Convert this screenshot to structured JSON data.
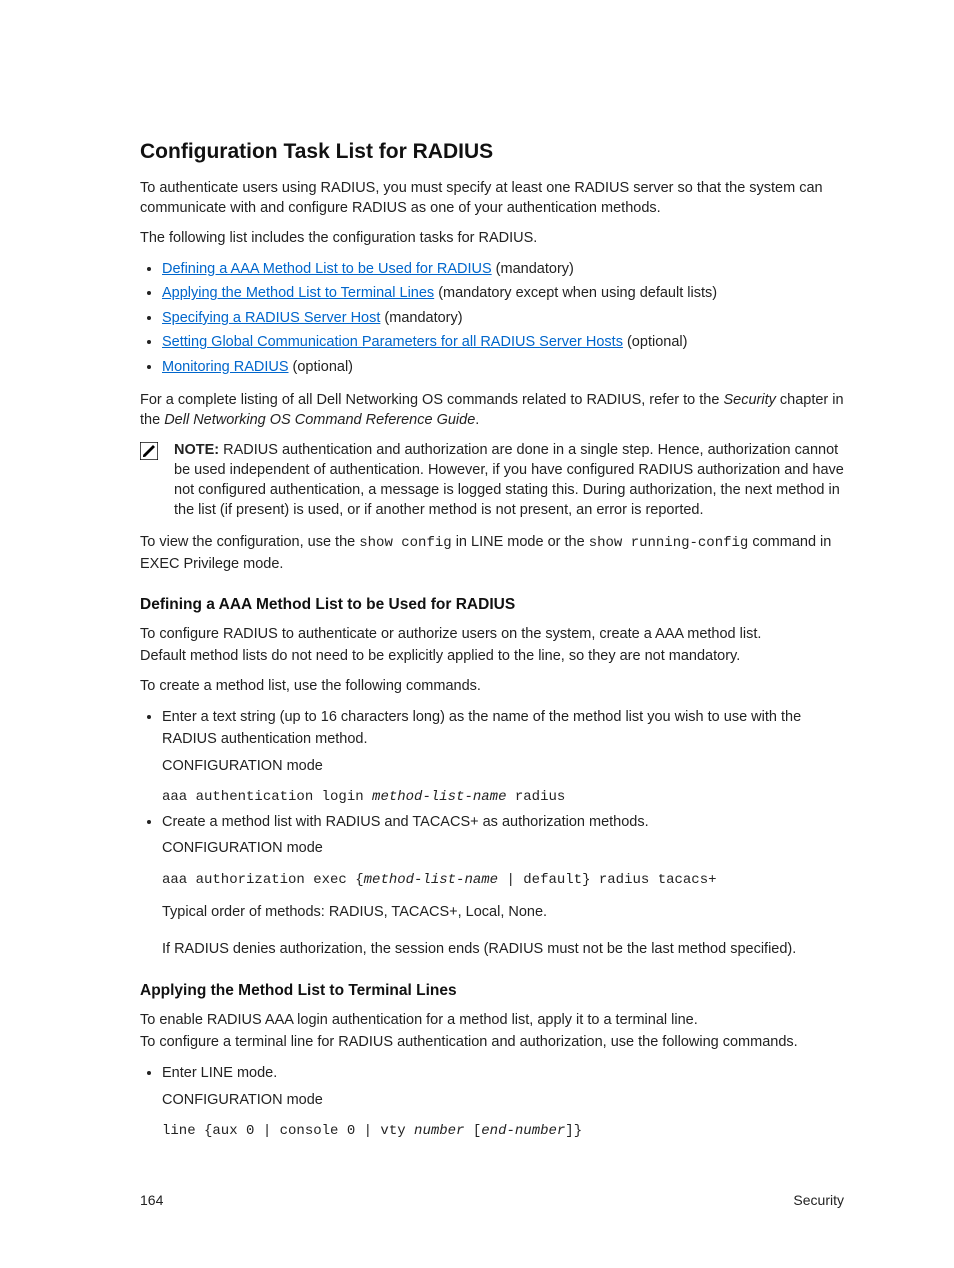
{
  "title": "Configuration Task List for RADIUS",
  "intro1": "To authenticate users using RADIUS, you must specify at least one RADIUS server so that the system can communicate with and configure RADIUS as one of your authentication methods.",
  "intro2": "The following list includes the configuration tasks for RADIUS.",
  "tasks": [
    {
      "link": "Defining a AAA Method List to be Used for RADIUS",
      "suffix": " (mandatory)"
    },
    {
      "link": "Applying the Method List to Terminal Lines",
      "suffix": " (mandatory except when using default lists)"
    },
    {
      "link": "Specifying a RADIUS Server Host",
      "suffix": " (mandatory)"
    },
    {
      "link": "Setting Global Communication Parameters for all RADIUS Server Hosts",
      "suffix": " (optional)"
    },
    {
      "link": "Monitoring RADIUS",
      "suffix": " (optional)"
    }
  ],
  "ref_pre": "For a complete listing of all Dell Networking OS commands related to RADIUS, refer to the ",
  "ref_italic1": "Security",
  "ref_mid": " chapter in the ",
  "ref_italic2": "Dell Networking OS Command Reference Guide",
  "ref_post": ".",
  "note_label": "NOTE: ",
  "note_body": "RADIUS authentication and authorization are done in a single step. Hence, authorization cannot be used independent of authentication. However, if you have configured RADIUS authorization and have not configured authentication, a message is logged stating this. During authorization, the next method in the list (if present) is used, or if another method is not present, an error is reported.",
  "view1": "To view the configuration, use the ",
  "view_cmd1": "show config",
  "view2": " in LINE mode or the ",
  "view_cmd2": "show running-config",
  "view3": " command in EXEC Privilege mode.",
  "sec1_title": "Defining a AAA Method List to be Used for RADIUS",
  "sec1_p1": "To configure RADIUS to authenticate or authorize users on the system, create a AAA method list.",
  "sec1_p2": "Default method lists do not need to be explicitly applied to the line, so they are not mandatory.",
  "sec1_p3": "To create a method list, use the following commands.",
  "sec1_li1": "Enter a text string (up to 16 characters long) as the name of the method list you wish to use with the RADIUS authentication method.",
  "conf_mode": "CONFIGURATION mode",
  "sec1_cmd1_a": "aaa authentication login ",
  "sec1_cmd1_b": "method-list-name",
  "sec1_cmd1_c": " radius",
  "sec1_li2": "Create a method list with RADIUS and TACACS+ as authorization methods.",
  "sec1_cmd2_a": "aaa authorization exec {",
  "sec1_cmd2_b": "method-list-name",
  "sec1_cmd2_c": " | default} radius tacacs+",
  "sec1_note1": "Typical order of methods: RADIUS, TACACS+, Local, None.",
  "sec1_note2": "If RADIUS denies authorization, the session ends (RADIUS must not be the last method specified).",
  "sec2_title": "Applying the Method List to Terminal Lines",
  "sec2_p1": "To enable RADIUS AAA login authentication for a method list, apply it to a terminal line.",
  "sec2_p2": "To configure a terminal line for RADIUS authentication and authorization, use the following commands.",
  "sec2_li1": "Enter LINE mode.",
  "sec2_cmd_a": "line {aux 0 | console 0 | vty ",
  "sec2_cmd_b": "number",
  "sec2_cmd_c": " [",
  "sec2_cmd_d": "end-number",
  "sec2_cmd_e": "]}",
  "page_number": "164",
  "chapter": "Security"
}
